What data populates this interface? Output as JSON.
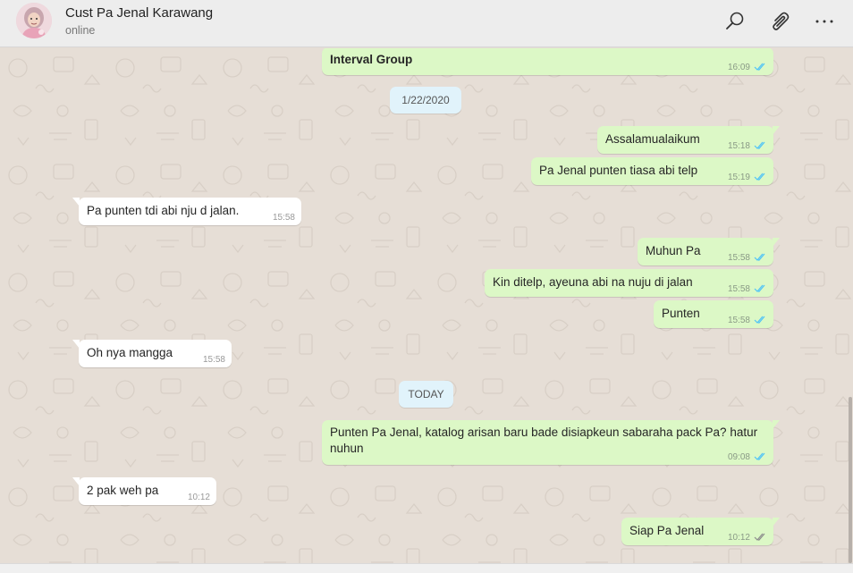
{
  "header": {
    "contact_name": "Cust Pa Jenal Karawang",
    "status": "online",
    "icons": [
      "avatar",
      "search-icon",
      "attach-icon",
      "more-options-icon"
    ]
  },
  "colors": {
    "outgoing_bubble": "#dcf8c6",
    "incoming_bubble": "#ffffff",
    "date_chip": "#e1f3fb",
    "read_ticks": "#4fc3f7",
    "delivered_ticks": "#8c8c8c"
  },
  "messages": [
    {
      "text": "Interval Group",
      "time": "16:09",
      "status": "read"
    },
    {
      "date": "1/22/2020"
    },
    {
      "text": "Assalamualaikum",
      "time": "15:18",
      "status": "read"
    },
    {
      "text": "Pa Jenal punten tiasa abi telp",
      "time": "15:19",
      "status": "read"
    },
    {
      "text": "Pa punten tdi abi nju d jalan.",
      "time": "15:58"
    },
    {
      "text": "Muhun Pa",
      "time": "15:58",
      "status": "read"
    },
    {
      "text": "Kin ditelp, ayeuna abi na nuju di jalan",
      "time": "15:58",
      "status": "read"
    },
    {
      "text": "Punten",
      "time": "15:58",
      "status": "read"
    },
    {
      "text": "Oh nya mangga",
      "time": "15:58"
    },
    {
      "date": "TODAY"
    },
    {
      "text": "Punten Pa Jenal, katalog arisan baru bade disiapkeun sabaraha pack Pa? hatur nuhun",
      "time": "09:08",
      "status": "read"
    },
    {
      "text": "2 pak weh pa",
      "time": "10:12"
    },
    {
      "text": "Siap Pa Jenal",
      "time": "10:12",
      "status": "delivered"
    }
  ]
}
